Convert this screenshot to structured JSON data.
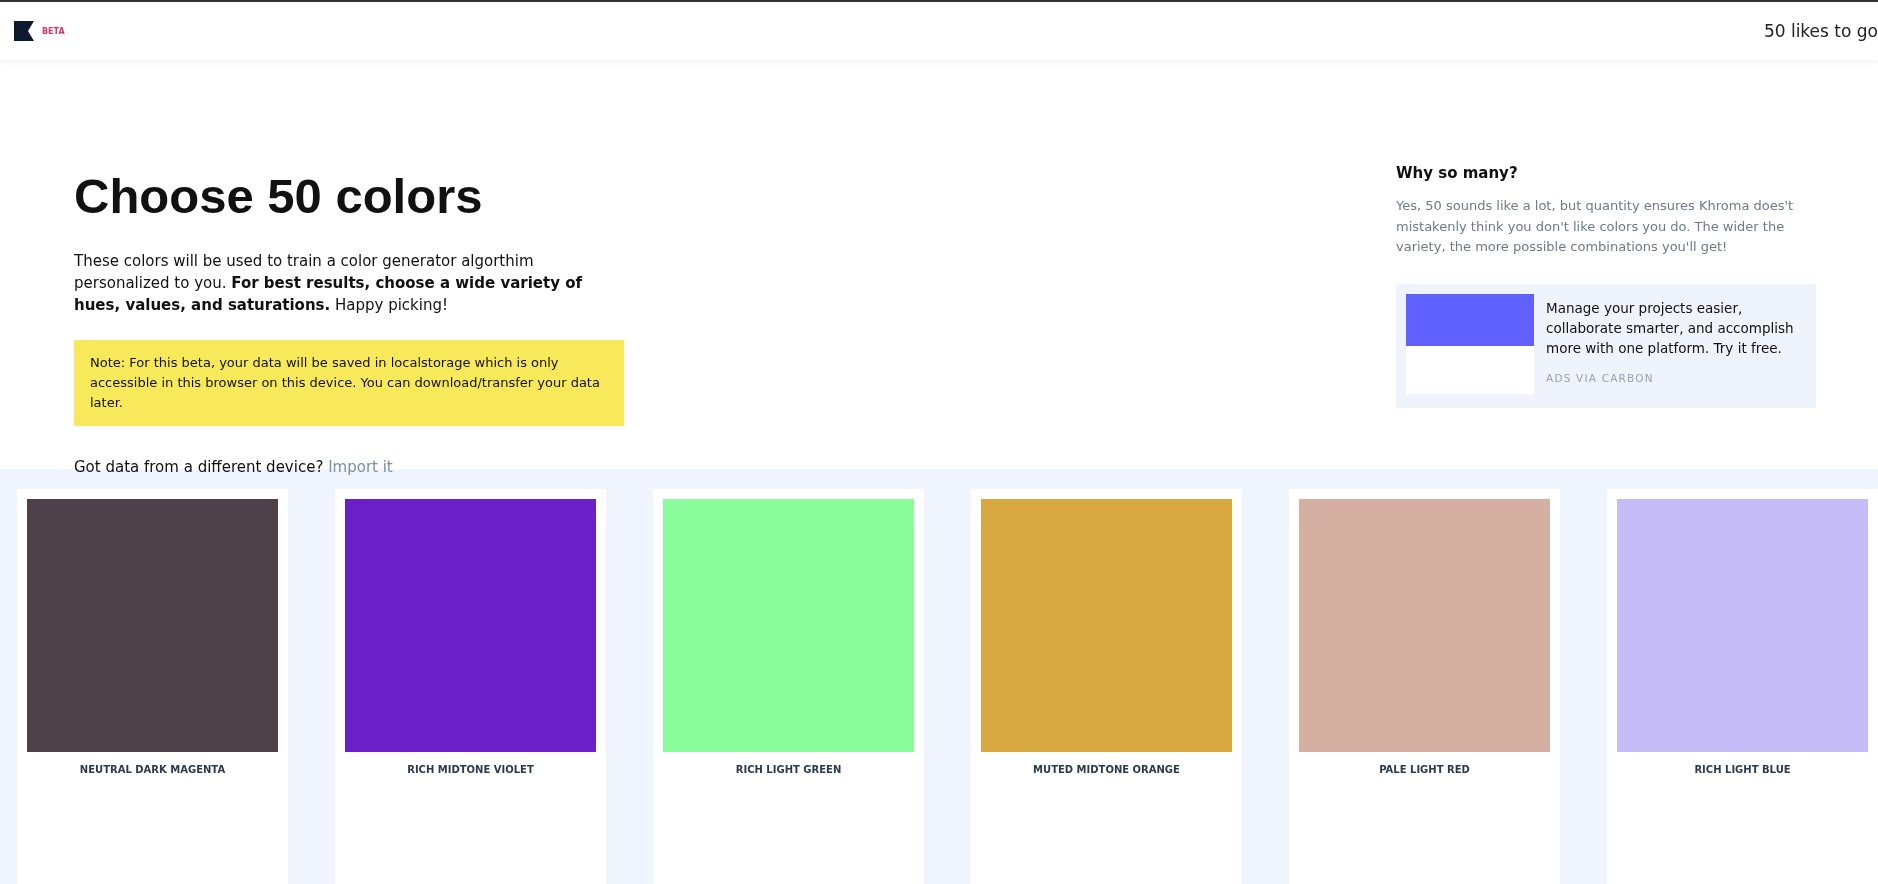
{
  "header": {
    "badge": "BETA",
    "likes": "50 likes to go"
  },
  "intro": {
    "title": "Choose 50 colors",
    "paragraph": "These colors will be used to train a color generator algorthim personalized to you. **For best results, choose a wide variety of hues, values, and saturations.** Happy picking!",
    "note": "Note: For this beta, your data will be saved in localstorage which is only accessible in this browser on this device. You can download/transfer your data later.",
    "import_prompt": "Got data from a different device?",
    "import_link": "Import it"
  },
  "aside": {
    "heading": "Why so many?",
    "body": "Yes, 50 sounds like a lot, but quantity ensures Khroma does't mistakenly think you don't like colors you do. The wider the variety, the more possible combinations you'll get!"
  },
  "ad": {
    "text": "Manage your projects easier, collaborate smarter, and accomplish more with one platform. Try it free.",
    "attribution": "ADS VIA CARBON"
  },
  "swatches": [
    {
      "name": "NEUTRAL DARK MAGENTA",
      "color": "#4f4149"
    },
    {
      "name": "RICH MIDTONE VIOLET",
      "color": "#6a1fc9"
    },
    {
      "name": "RICH LIGHT GREEN",
      "color": "#8afc9c"
    },
    {
      "name": "MUTED MIDTONE ORANGE",
      "color": "#d8a942"
    },
    {
      "name": "PALE LIGHT RED",
      "color": "#d5b0a2"
    },
    {
      "name": "RICH LIGHT BLUE",
      "color": "#c6bcf8"
    }
  ]
}
